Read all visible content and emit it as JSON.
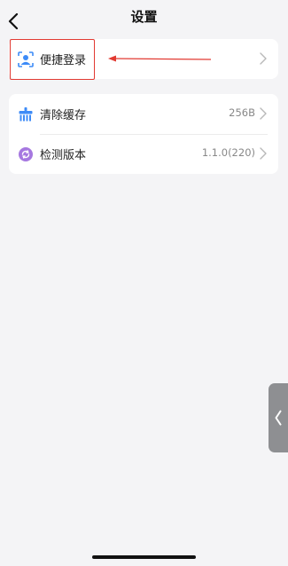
{
  "header": {
    "title": "设置"
  },
  "settings": {
    "quick_login": {
      "label": "便捷登录",
      "icon": "face-id-icon"
    },
    "clear_cache": {
      "label": "清除缓存",
      "value": "256B",
      "icon": "broom-icon"
    },
    "check_version": {
      "label": "检测版本",
      "value": "1.1.0(220)",
      "icon": "version-icon"
    }
  },
  "colors": {
    "accent_blue": "#3d8bf7",
    "purple": "#a678e0",
    "annotation_red": "#e23a32"
  }
}
